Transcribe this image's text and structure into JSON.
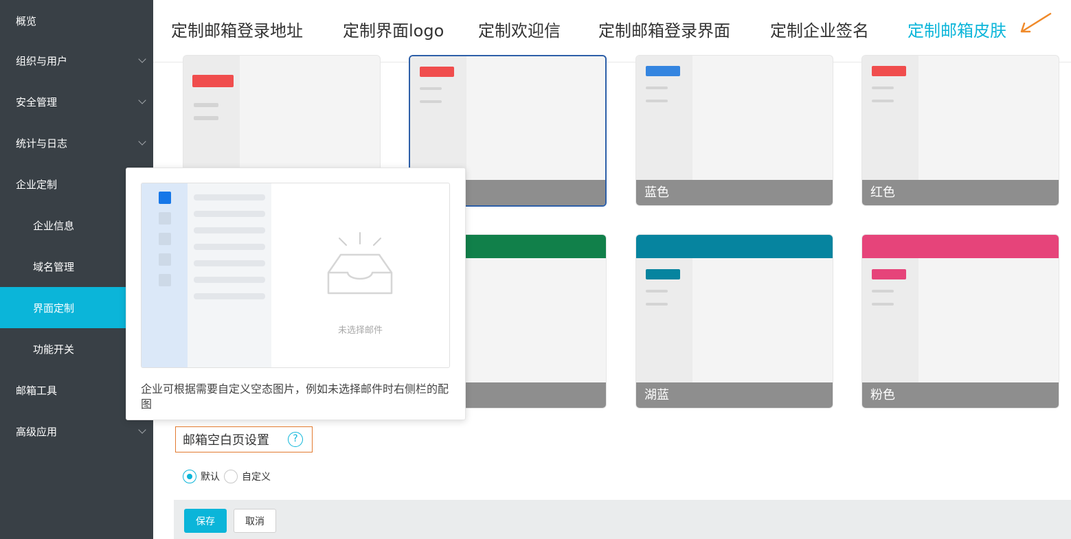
{
  "sidebar": {
    "items": [
      {
        "label": "概览"
      },
      {
        "label": "组织与用户"
      },
      {
        "label": "安全管理"
      },
      {
        "label": "统计与日志"
      },
      {
        "label": "企业定制"
      },
      {
        "label": "企业信息"
      },
      {
        "label": "域名管理"
      },
      {
        "label": "界面定制"
      },
      {
        "label": "功能开关"
      },
      {
        "label": "邮箱工具"
      },
      {
        "label": "高级应用"
      }
    ]
  },
  "tabs": [
    {
      "label": "定制邮箱登录地址"
    },
    {
      "label": "定制界面logo"
    },
    {
      "label": "定制欢迎信"
    },
    {
      "label": "定制邮箱登录界面"
    },
    {
      "label": "定制企业签名"
    },
    {
      "label": "定制邮箱皮肤"
    }
  ],
  "skins": [
    {
      "label": "",
      "color": "#f04d4d"
    },
    {
      "label": "",
      "color": "#f04d4d"
    },
    {
      "label": "蓝色",
      "color": "#3485e0"
    },
    {
      "label": "红色",
      "color": "#f04d4d"
    },
    {
      "label": "",
      "color": "#11804a"
    },
    {
      "label": "湖蓝",
      "color": "#06849f"
    },
    {
      "label": "粉色",
      "color": "#e6447a"
    }
  ],
  "popover": {
    "empty_text": "未选择邮件",
    "description": "企业可根据需要自定义空态图片，例如未选择邮件时右侧栏的配图"
  },
  "blank_page": {
    "title": "邮箱空白页设置",
    "help": "?",
    "options": [
      "默认",
      "自定义"
    ],
    "selected": "默认"
  },
  "actions": {
    "save_label": "保存",
    "cancel_label": "取消"
  },
  "colors": {
    "accent": "#0bb5d9",
    "sidebar_bg": "#394046",
    "arrow": "#f08a2a"
  }
}
